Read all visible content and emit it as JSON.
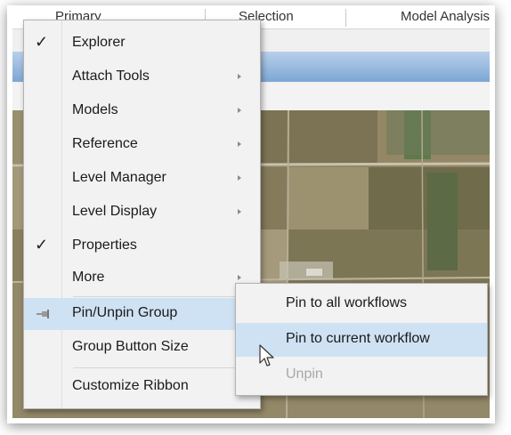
{
  "tabs": [
    "Primary",
    "Selection",
    "Model Analysis"
  ],
  "main_menu": {
    "items": [
      {
        "label": "Explorer",
        "checked": true,
        "has_submenu": false
      },
      {
        "label": "Attach Tools",
        "checked": false,
        "has_submenu": true
      },
      {
        "label": "Models",
        "checked": false,
        "has_submenu": true
      },
      {
        "label": "Reference",
        "checked": false,
        "has_submenu": true
      },
      {
        "label": "Level Manager",
        "checked": false,
        "has_submenu": true
      },
      {
        "label": "Level Display",
        "checked": false,
        "has_submenu": true
      },
      {
        "label": "Properties",
        "checked": true,
        "has_submenu": false
      },
      {
        "label": "More",
        "checked": false,
        "has_submenu": true
      },
      {
        "label": "Pin/Unpin Group",
        "checked": false,
        "has_submenu": true,
        "icon": "pin-icon",
        "highlighted": true
      },
      {
        "label": "Group Button Size",
        "checked": false,
        "has_submenu": true
      },
      {
        "label": "Customize Ribbon",
        "checked": false,
        "has_submenu": false
      }
    ],
    "check_glyph": "✓"
  },
  "submenu": {
    "items": [
      {
        "label": "Pin to all workflows",
        "enabled": true
      },
      {
        "label": "Pin to current workflow",
        "enabled": true,
        "highlighted": true
      },
      {
        "label": "Unpin",
        "enabled": false
      }
    ]
  },
  "colors": {
    "menu_bg": "#f2f2f2",
    "highlight": "#cfe2f3",
    "ribbon_blue": "#7da6d4",
    "disabled_text": "#a8a8a8"
  },
  "cursor": "arrow-pointer-icon"
}
